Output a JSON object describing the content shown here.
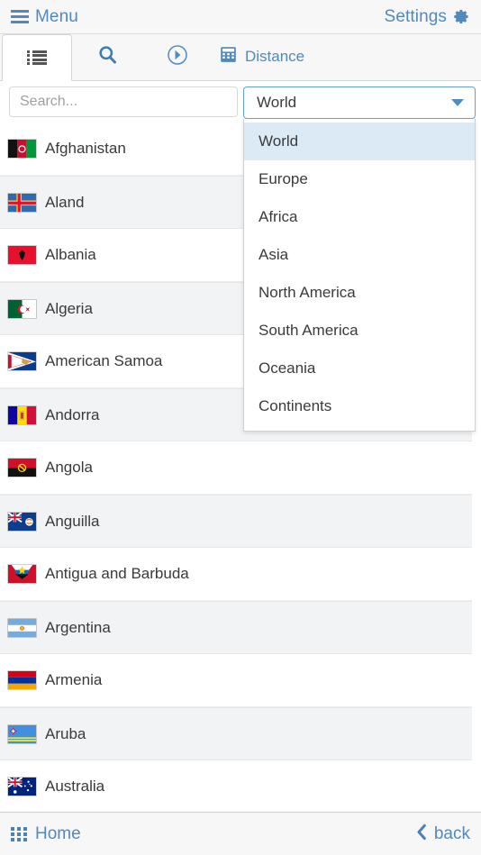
{
  "header": {
    "menu_label": "Menu",
    "settings_label": "Settings",
    "menu_icon": "hamburger-icon",
    "settings_icon": "gear-icon"
  },
  "tabs": [
    {
      "id": "list",
      "label": "",
      "icon": "list-view-icon",
      "active": true
    },
    {
      "id": "search",
      "label": "",
      "icon": "search-icon",
      "active": false
    },
    {
      "id": "nearby",
      "label": "",
      "icon": "circle-chevron-right-icon",
      "active": false
    },
    {
      "id": "distance",
      "label": "Distance",
      "icon": "calculator-icon",
      "active": false
    }
  ],
  "filter": {
    "search_placeholder": "Search...",
    "search_value": "",
    "region_selected": "World",
    "region_options": [
      "World",
      "Europe",
      "Africa",
      "Asia",
      "North America",
      "South America",
      "Oceania",
      "Continents"
    ],
    "dropdown_open": true
  },
  "countries": [
    {
      "name": "Afghanistan",
      "flag": "af"
    },
    {
      "name": "Aland",
      "flag": "ax"
    },
    {
      "name": "Albania",
      "flag": "al"
    },
    {
      "name": "Algeria",
      "flag": "dz"
    },
    {
      "name": "American Samoa",
      "flag": "as"
    },
    {
      "name": "Andorra",
      "flag": "ad"
    },
    {
      "name": "Angola",
      "flag": "ao"
    },
    {
      "name": "Anguilla",
      "flag": "ai"
    },
    {
      "name": "Antigua and Barbuda",
      "flag": "ag"
    },
    {
      "name": "Argentina",
      "flag": "ar"
    },
    {
      "name": "Armenia",
      "flag": "am"
    },
    {
      "name": "Aruba",
      "flag": "aw"
    },
    {
      "name": "Australia",
      "flag": "au"
    }
  ],
  "bottom": {
    "home_label": "Home",
    "back_label": "back",
    "home_icon": "grid-icon",
    "back_icon": "chevron-left-icon"
  },
  "colors": {
    "accent": "#5089bd",
    "header_bg": "#f7f7f7",
    "row_alt_bg": "#f2f3f5",
    "select_border": "#63a2d8",
    "dropdown_selected_bg": "#dbeaf4"
  }
}
